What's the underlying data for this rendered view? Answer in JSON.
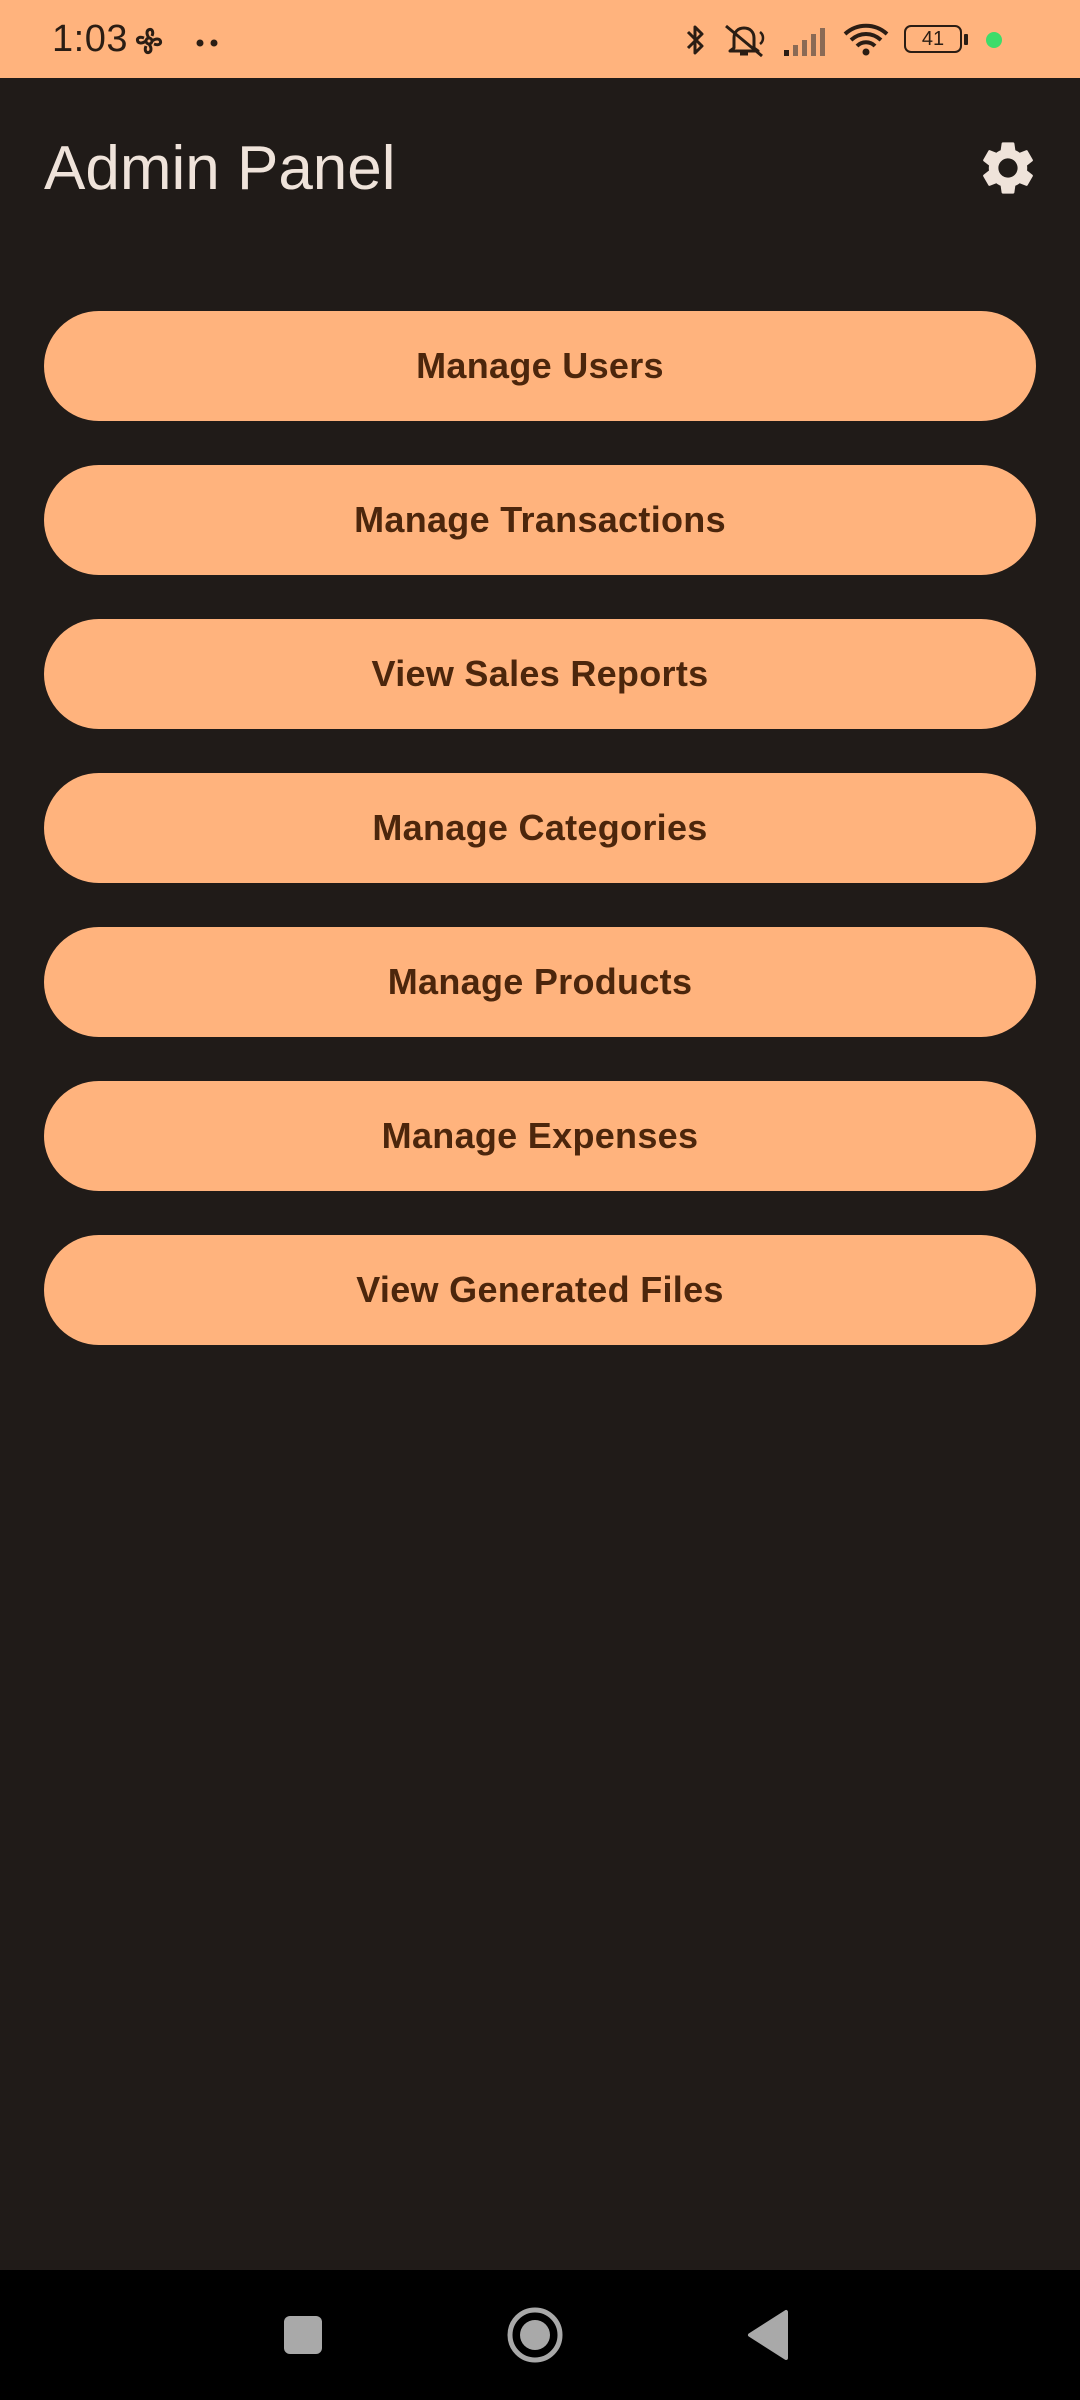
{
  "status_bar": {
    "time": "1:03",
    "battery_level": "41",
    "icons": [
      "fan-icon",
      "dots-icon",
      "bluetooth-icon",
      "bell-muted-icon",
      "signal-icon",
      "wifi-icon",
      "battery-icon",
      "privacy-dot-icon"
    ],
    "bg_color": "#ffb37d",
    "privacy_dot_color": "#3ddc6a"
  },
  "app_bar": {
    "title": "Admin Panel",
    "settings_icon": "gear-icon"
  },
  "menu": {
    "button_color": "#ffb37d",
    "text_color": "#4c260c",
    "items": [
      {
        "label": "Manage Users"
      },
      {
        "label": "Manage Transactions"
      },
      {
        "label": "View Sales Reports"
      },
      {
        "label": "Manage Categories"
      },
      {
        "label": "Manage Products"
      },
      {
        "label": "Manage Expenses"
      },
      {
        "label": "View Generated Files"
      }
    ]
  },
  "nav_bar": {
    "buttons": [
      "recents-square-icon",
      "home-circle-icon",
      "back-triangle-icon"
    ]
  },
  "theme": {
    "background": "#201b18",
    "title_color": "#efe3da"
  }
}
